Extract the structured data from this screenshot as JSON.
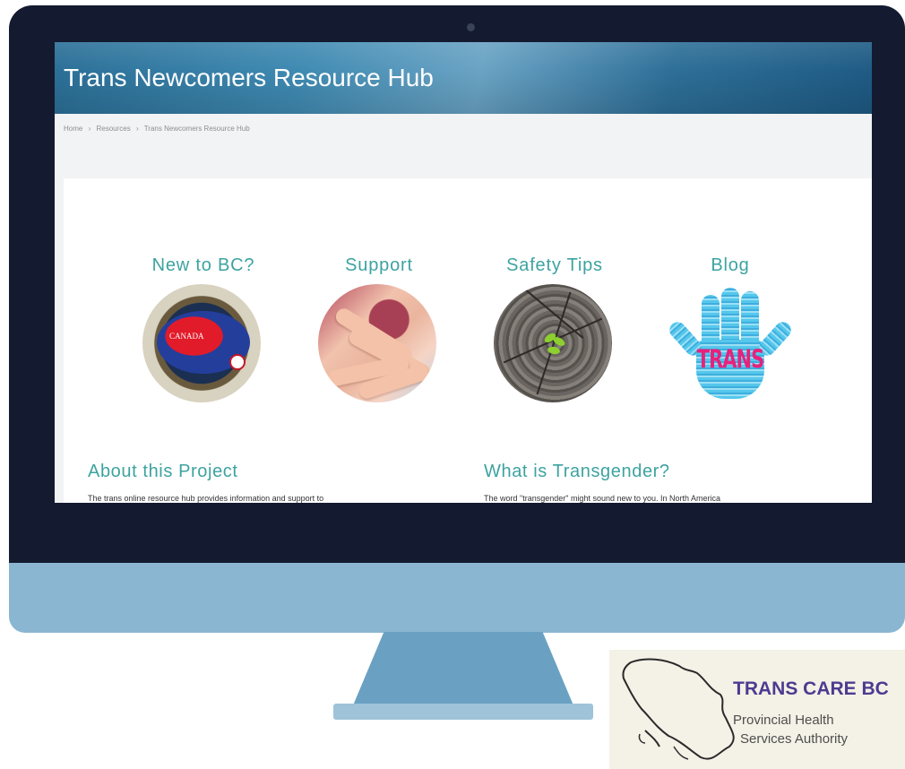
{
  "site": {
    "title": "Trans Newcomers Resource Hub"
  },
  "breadcrumb": [
    "Home",
    "Resources",
    "Trans Newcomers Resource Hub"
  ],
  "breadcrumb_separator": "›",
  "cards": [
    {
      "label": "New to BC?",
      "image_label": "CANADA",
      "icon": "canada-map-icon"
    },
    {
      "label": "Support",
      "icon": "holding-hands-icon"
    },
    {
      "label": "Safety Tips",
      "icon": "sprout-stump-icon"
    },
    {
      "label": "Blog",
      "image_label": "TRANS",
      "icon": "trans-word-hand-icon"
    }
  ],
  "sections": [
    {
      "heading": "About this Project",
      "text": "The trans online resource hub provides information and support to"
    },
    {
      "heading": "What is Transgender?",
      "text": "The word \"transgender\" might sound new to you. In North America"
    }
  ],
  "logo": {
    "name": "TRANS CARE BC",
    "org_line1": "Provincial Health",
    "org_line2": "Services Authority"
  },
  "colors": {
    "bezel": "#141a30",
    "chin": "#8bb6d1",
    "stand": "#6aa1c3",
    "header_blue": "#2b6f97",
    "accent_teal": "#3da3a0",
    "logo_purple": "#4c3b91"
  }
}
